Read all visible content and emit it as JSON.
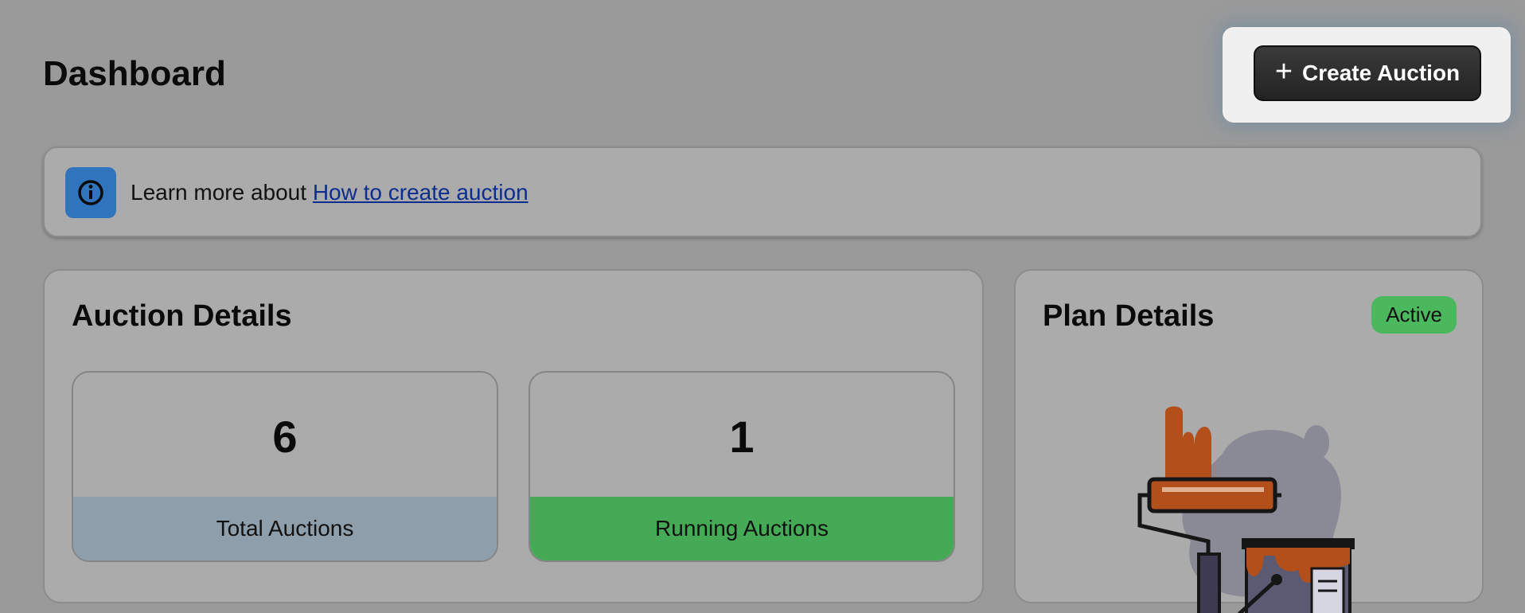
{
  "header": {
    "title": "Dashboard"
  },
  "actions": {
    "create_label": "Create Auction",
    "create_icon": "plus-icon"
  },
  "banner": {
    "icon": "info-icon",
    "text": "Learn more about",
    "link_text": "How to create auction"
  },
  "auction_details": {
    "title": "Auction Details",
    "stats": [
      {
        "value": "6",
        "label": "Total Auctions",
        "color": "#8f9eab"
      },
      {
        "value": "1",
        "label": "Running Auctions",
        "color": "#44aa55"
      }
    ]
  },
  "plan_details": {
    "title": "Plan Details",
    "status": "Active",
    "status_color": "#4cb85e",
    "illustration": "paint-roller-illustration"
  }
}
